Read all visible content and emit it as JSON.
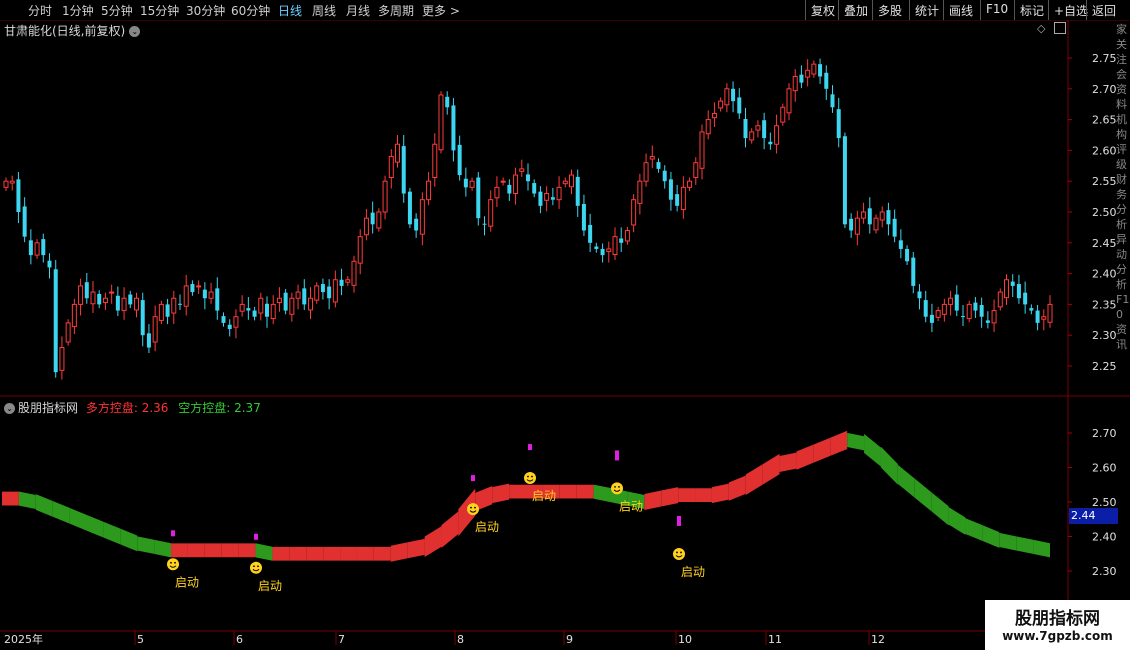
{
  "toolbar": {
    "periods": [
      {
        "label": "分时",
        "x": 28
      },
      {
        "label": "1分钟",
        "x": 62
      },
      {
        "label": "5分钟",
        "x": 101
      },
      {
        "label": "15分钟",
        "x": 140
      },
      {
        "label": "30分钟",
        "x": 186
      },
      {
        "label": "60分钟",
        "x": 231
      },
      {
        "label": "日线",
        "x": 278,
        "active": true
      },
      {
        "label": "周线",
        "x": 312
      },
      {
        "label": "月线",
        "x": 346
      },
      {
        "label": "多周期",
        "x": 378
      },
      {
        "label": "更多",
        "x": 422
      }
    ],
    "more_arrow": ">",
    "right_buttons": [
      "复权",
      "叠加",
      "多股",
      "统计",
      "画线",
      "F10",
      "标记",
      "+自选",
      "返回"
    ]
  },
  "main_title": "甘肃能化(日线,前复权)",
  "sub_indicator": {
    "name": "股朋指标网",
    "bull_label": "多方控盘: 2.36",
    "bear_label": "空方控盘: 2.37",
    "bull_color": "#ff3333",
    "bear_color": "#33cc33"
  },
  "price_axis": [
    "2.75",
    "2.70",
    "2.65",
    "2.60",
    "2.55",
    "2.50",
    "2.45",
    "2.40",
    "2.35",
    "2.30",
    "2.25"
  ],
  "sub_axis": [
    "2.70",
    "2.60",
    "2.50",
    "2.40",
    "2.30"
  ],
  "current_value": "2.44",
  "date_axis": [
    {
      "label": "2025年",
      "x": 4
    },
    {
      "label": "5",
      "x": 137
    },
    {
      "label": "6",
      "x": 236
    },
    {
      "label": "7",
      "x": 338
    },
    {
      "label": "8",
      "x": 457
    },
    {
      "label": "9",
      "x": 566
    },
    {
      "label": "10",
      "x": 678
    },
    {
      "label": "11",
      "x": 768
    },
    {
      "label": "12",
      "x": 871
    }
  ],
  "signal_label": "启动",
  "right_strip_text": "家关注会资料机构评级财务分析异动分析F10资讯",
  "watermark": {
    "title": "股朋指标网",
    "url": "www.7gpzb.com"
  },
  "icons": {
    "diamond": "◇",
    "panel": "▣",
    "chevron": "⌄",
    "smiley": "smiley-icon"
  },
  "chart_data": {
    "type": "candlestick",
    "title": "甘肃能化(日线,前复权)",
    "ylim": [
      2.22,
      2.78
    ],
    "x_ticks": [
      "2025年",
      "5",
      "6",
      "7",
      "8",
      "9",
      "10",
      "11",
      "12"
    ],
    "close": [
      2.55,
      2.55,
      2.5,
      2.46,
      2.43,
      2.45,
      2.43,
      2.41,
      2.24,
      2.28,
      2.32,
      2.35,
      2.38,
      2.36,
      2.37,
      2.35,
      2.36,
      2.37,
      2.34,
      2.36,
      2.35,
      2.36,
      2.3,
      2.28,
      2.33,
      2.35,
      2.33,
      2.36,
      2.35,
      2.38,
      2.37,
      2.38,
      2.36,
      2.37,
      2.34,
      2.32,
      2.31,
      2.33,
      2.35,
      2.34,
      2.33,
      2.36,
      2.33,
      2.35,
      2.36,
      2.34,
      2.36,
      2.37,
      2.35,
      2.36,
      2.38,
      2.37,
      2.36,
      2.39,
      2.38,
      2.39,
      2.42,
      2.46,
      2.49,
      2.48,
      2.5,
      2.55,
      2.59,
      2.61,
      2.53,
      2.48,
      2.47,
      2.52,
      2.55,
      2.61,
      2.69,
      2.67,
      2.6,
      2.56,
      2.54,
      2.55,
      2.49,
      2.48,
      2.52,
      2.54,
      2.55,
      2.53,
      2.56,
      2.57,
      2.55,
      2.53,
      2.51,
      2.53,
      2.52,
      2.54,
      2.55,
      2.56,
      2.51,
      2.47,
      2.45,
      2.44,
      2.43,
      2.44,
      2.46,
      2.45,
      2.47,
      2.52,
      2.55,
      2.58,
      2.59,
      2.57,
      2.55,
      2.52,
      2.51,
      2.54,
      2.55,
      2.58,
      2.63,
      2.65,
      2.66,
      2.68,
      2.7,
      2.68,
      2.66,
      2.62,
      2.63,
      2.64,
      2.62,
      2.61,
      2.64,
      2.67,
      2.7,
      2.72,
      2.71,
      2.73,
      2.74,
      2.72,
      2.7,
      2.67,
      2.62,
      2.48,
      2.47,
      2.49,
      2.5,
      2.48,
      2.49,
      2.5,
      2.48,
      2.46,
      2.44,
      2.42,
      2.38,
      2.36,
      2.33,
      2.32,
      2.34,
      2.35,
      2.36,
      2.34,
      2.33,
      2.35,
      2.34,
      2.33,
      2.32,
      2.34,
      2.37,
      2.39,
      2.38,
      2.36,
      2.35,
      2.34,
      2.32,
      2.33,
      2.35
    ],
    "bull_band": [
      2.51,
      2.51,
      2.5,
      2.48,
      2.46,
      2.44,
      2.42,
      2.4,
      2.38,
      2.37,
      2.36,
      2.36,
      2.36,
      2.36,
      2.36,
      2.36,
      2.35,
      2.35,
      2.35,
      2.35,
      2.35,
      2.35,
      2.35,
      2.35,
      2.36,
      2.37,
      2.4,
      2.44,
      2.5,
      2.52,
      2.53,
      2.53,
      2.53,
      2.53,
      2.53,
      2.53,
      2.52,
      2.51,
      2.5,
      2.51,
      2.52,
      2.52,
      2.52,
      2.53,
      2.55,
      2.58,
      2.61,
      2.62,
      2.64,
      2.66,
      2.68,
      2.67,
      2.63,
      2.58,
      2.54,
      2.5,
      2.46,
      2.43,
      2.41,
      2.39,
      2.38,
      2.37,
      2.36
    ]
  }
}
